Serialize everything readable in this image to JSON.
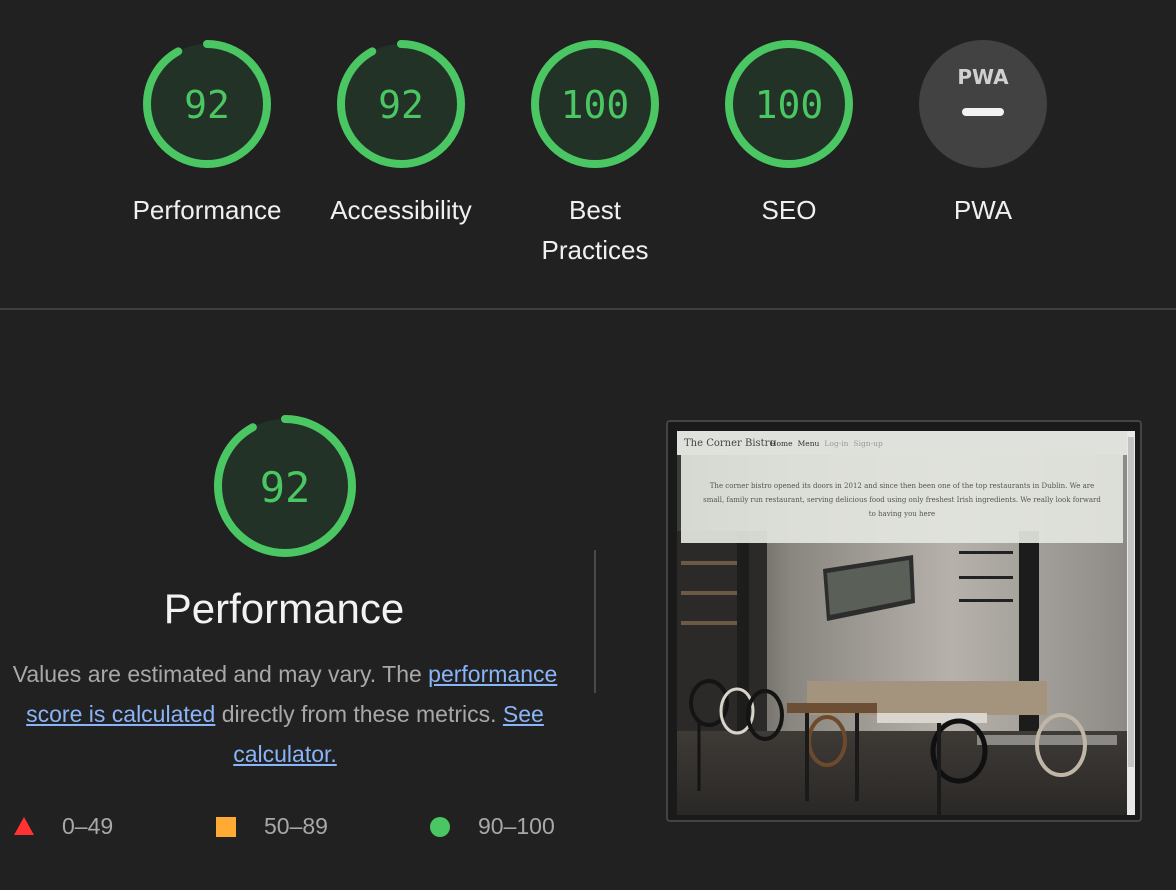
{
  "gauges": [
    {
      "label": "Performance",
      "score": "92",
      "value": 92
    },
    {
      "label": "Accessibility",
      "score": "92",
      "value": 92
    },
    {
      "label": "Best Practices",
      "score": "100",
      "value": 100
    },
    {
      "label": "SEO",
      "score": "100",
      "value": 100
    },
    {
      "label": "PWA",
      "badge": "PWA"
    }
  ],
  "performance": {
    "score": "92",
    "value": 92,
    "title": "Performance",
    "desc_prefix": "Values are estimated and may vary. The ",
    "desc_link1": "performance score is calculated",
    "desc_middle": " directly from these metrics. ",
    "desc_link2": "See calculator."
  },
  "legend": [
    {
      "range": "0–49",
      "shape": "triangle",
      "color": "#ff3333"
    },
    {
      "range": "50–89",
      "shape": "square",
      "color": "#ffaa33"
    },
    {
      "range": "90–100",
      "shape": "circle",
      "color": "#4ac763"
    }
  ],
  "screenshot": {
    "brand": "The Corner Bistro",
    "nav_links": [
      "Home",
      "Menu",
      "Log-in",
      "Sign-up"
    ],
    "hero_text": "The corner bistro opened its doors in 2012 and since then been one of the top restaurants in Dublin. We are small, family run restaurant, serving delicious food using only freshest Irish ingredients. We really look forward to having you here"
  },
  "colors": {
    "pass": "#4ac763",
    "pass_bg": "#233226",
    "pwa_bg": "#424242",
    "background": "#212121"
  }
}
